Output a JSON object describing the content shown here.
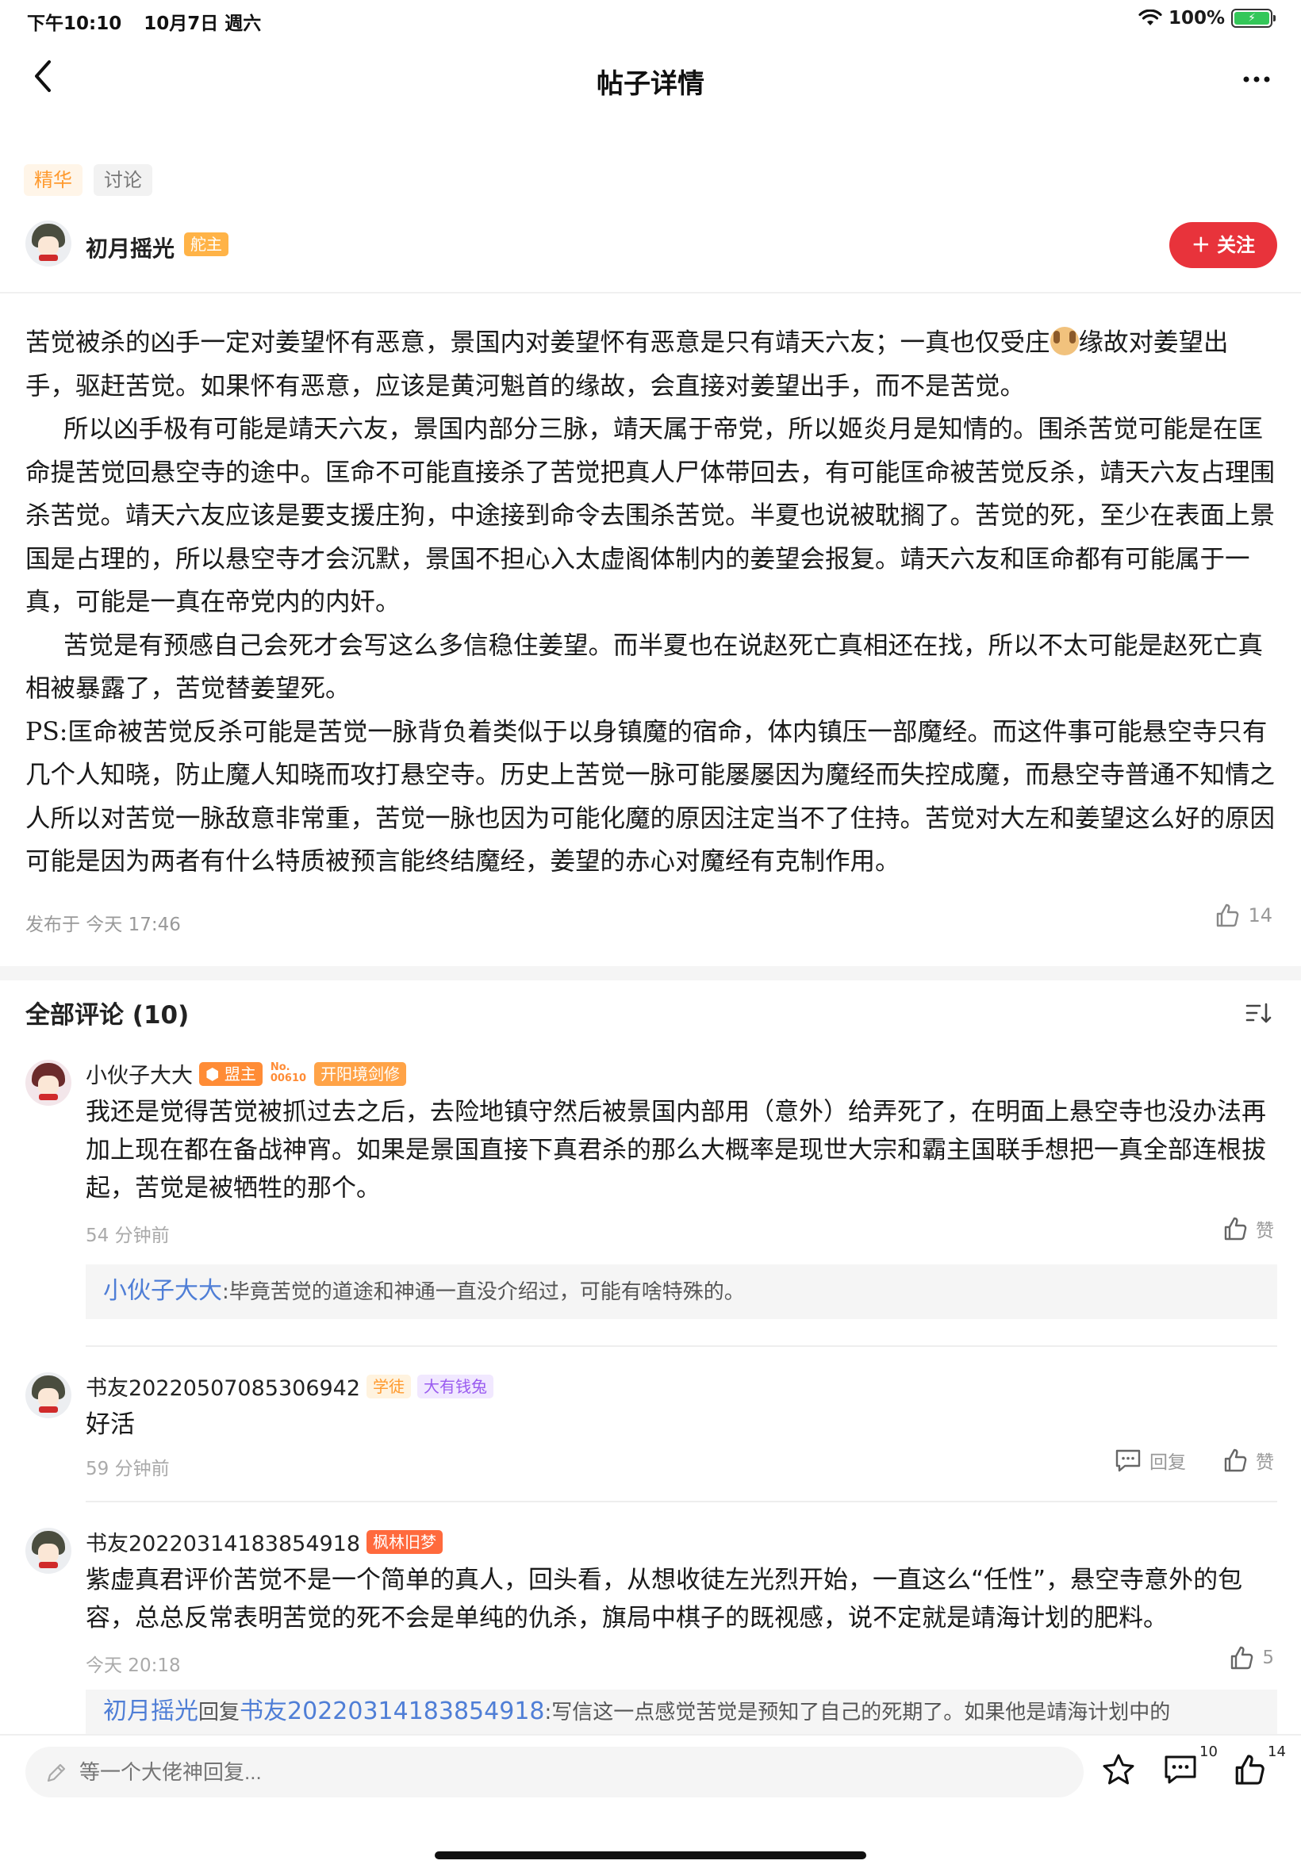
{
  "status_bar": {
    "time": "下午10:10",
    "date": "10月7日 週六",
    "battery": "100%"
  },
  "nav": {
    "title": "帖子详情"
  },
  "tags": [
    "精华",
    "讨论"
  ],
  "author": {
    "name": "初月摇光",
    "badge": "舵主",
    "follow_label": "关注"
  },
  "post": {
    "p1a": "苦觉被杀的凶手一定对姜望怀有恶意，景国内对姜望怀有恶意是只有靖天六友；一真也仅受庄",
    "p1b": "缘故对姜望出手，驱赶苦觉。如果怀有恶意，应该是黄河魁首的缘故，会直接对姜望出手，而不是苦觉。",
    "p2": "所以凶手极有可能是靖天六友，景国内部分三脉，靖天属于帝党，所以姬炎月是知情的。围杀苦觉可能是在匡命提苦觉回悬空寺的途中。匡命不可能直接杀了苦觉把真人尸体带回去，有可能匡命被苦觉反杀，靖天六友占理围杀苦觉。靖天六友应该是要支援庄狗，中途接到命令去围杀苦觉。半夏也说被耽搁了。苦觉的死，至少在表面上景国是占理的，所以悬空寺才会沉默，景国不担心入太虚阁体制内的姜望会报复。靖天六友和匡命都有可能属于一真，可能是一真在帝党内的内奸。",
    "p3": "苦觉是有预感自己会死才会写这么多信稳住姜望。而半夏也在说赵死亡真相还在找，所以不太可能是赵死亡真相被暴露了，苦觉替姜望死。",
    "p4": "PS:匡命被苦觉反杀可能是苦觉一脉背负着类似于以身镇魔的宿命，体内镇压一部魔经。而这件事可能悬空寺只有几个人知晓，防止魔人知晓而攻打悬空寺。历史上苦觉一脉可能屡屡因为魔经而失控成魔，而悬空寺普通不知情之人所以对苦觉一脉敌意非常重，苦觉一脉也因为可能化魔的原因注定当不了住持。苦觉对大左和姜望这么好的原因可能是因为两者有什么特质被预言能终结魔经，姜望的赤心对魔经有克制作用。",
    "published": "发布于 今天 17:46",
    "likes": "14"
  },
  "comments_header": "全部评论 (10)",
  "comments": [
    {
      "name": "小伙子大大",
      "badge_leader": "盟主",
      "badge_no_top": "No.",
      "badge_no_num": "00610",
      "badge_level": "开阳境剑修",
      "text": "我还是觉得苦觉被抓过去之后，去险地镇守然后被景国内部用（意外）给弄死了，在明面上悬空寺也没办法再加上现在都在备战神宵。如果是景国直接下真君杀的那么大概率是现世大宗和霸主国联手想把一真全部连根拔起，苦觉是被牺牲的那个。",
      "time": "54 分钟前",
      "like_label": "赞",
      "reply_name": "小伙子大大",
      "reply_text": ":毕竟苦觉的道途和神通一直没介绍过，可能有啥特殊的。"
    },
    {
      "name": "书友20220507085306942",
      "badge1": "学徒",
      "badge2": "大有钱兔",
      "text": "好活",
      "time": "59 分钟前",
      "reply_label": "回复",
      "like_label": "赞"
    },
    {
      "name": "书友20220314183854918",
      "badge1": "枫林旧梦",
      "text": "紫虚真君评价苦觉不是一个简单的真人，回头看，从想收徒左光烈开始，一直这么“任性”，悬空寺意外的包容，总总反常表明苦觉的死不会是单纯的仇杀，旗局中棋子的既视感，说不定就是靖海计划的肥料。",
      "time": "今天 20:18",
      "likes": "5",
      "reply_from": "初月摇光",
      "reply_word": "回复",
      "reply_to": "书友20220314183854918",
      "reply_text": ":写信这一点感觉苦觉是预知了自己的死期了。如果他是靖海计划中的"
    }
  ],
  "bottom": {
    "placeholder": "等一个大佬神回复...",
    "comment_count": "10",
    "like_count": "14"
  },
  "colors": {
    "accent_red": "#e8333b",
    "essence_orange": "#ff9a2e",
    "link_blue": "#4f7ed6"
  }
}
